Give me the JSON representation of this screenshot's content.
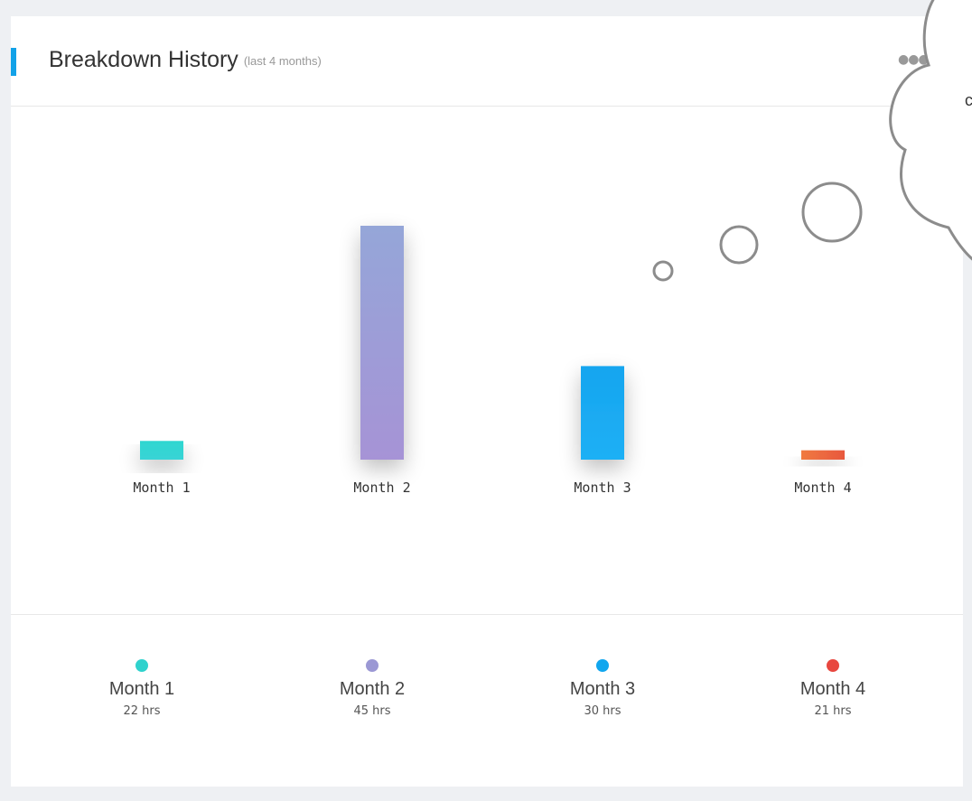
{
  "header": {
    "title": "Breakdown History",
    "subtitle": "(last 4 months)",
    "menu_icon": "more-dots-icon"
  },
  "colors": {
    "accent": "#12a2e8",
    "month1": "#2fd2cd",
    "month2": "#9b98d4",
    "month3": "#11a6ee",
    "month4": "#e8473f"
  },
  "chart_data": {
    "type": "bar",
    "categories": [
      "Month 1",
      "Month 2",
      "Month 3",
      "Month 4"
    ],
    "values": [
      22,
      45,
      30,
      21
    ],
    "unit": "hrs",
    "title": "Breakdown History",
    "subtitle": "(last 4 months)",
    "grid": false,
    "legend": "bottom"
  },
  "legend": [
    {
      "label": "Month 1",
      "value": "22 hrs"
    },
    {
      "label": "Month 2",
      "value": "45 hrs"
    },
    {
      "label": "Month 3",
      "value": "30 hrs"
    },
    {
      "label": "Month 4",
      "value": "21 hrs"
    }
  ],
  "thought_bubble": {
    "text": "c"
  }
}
